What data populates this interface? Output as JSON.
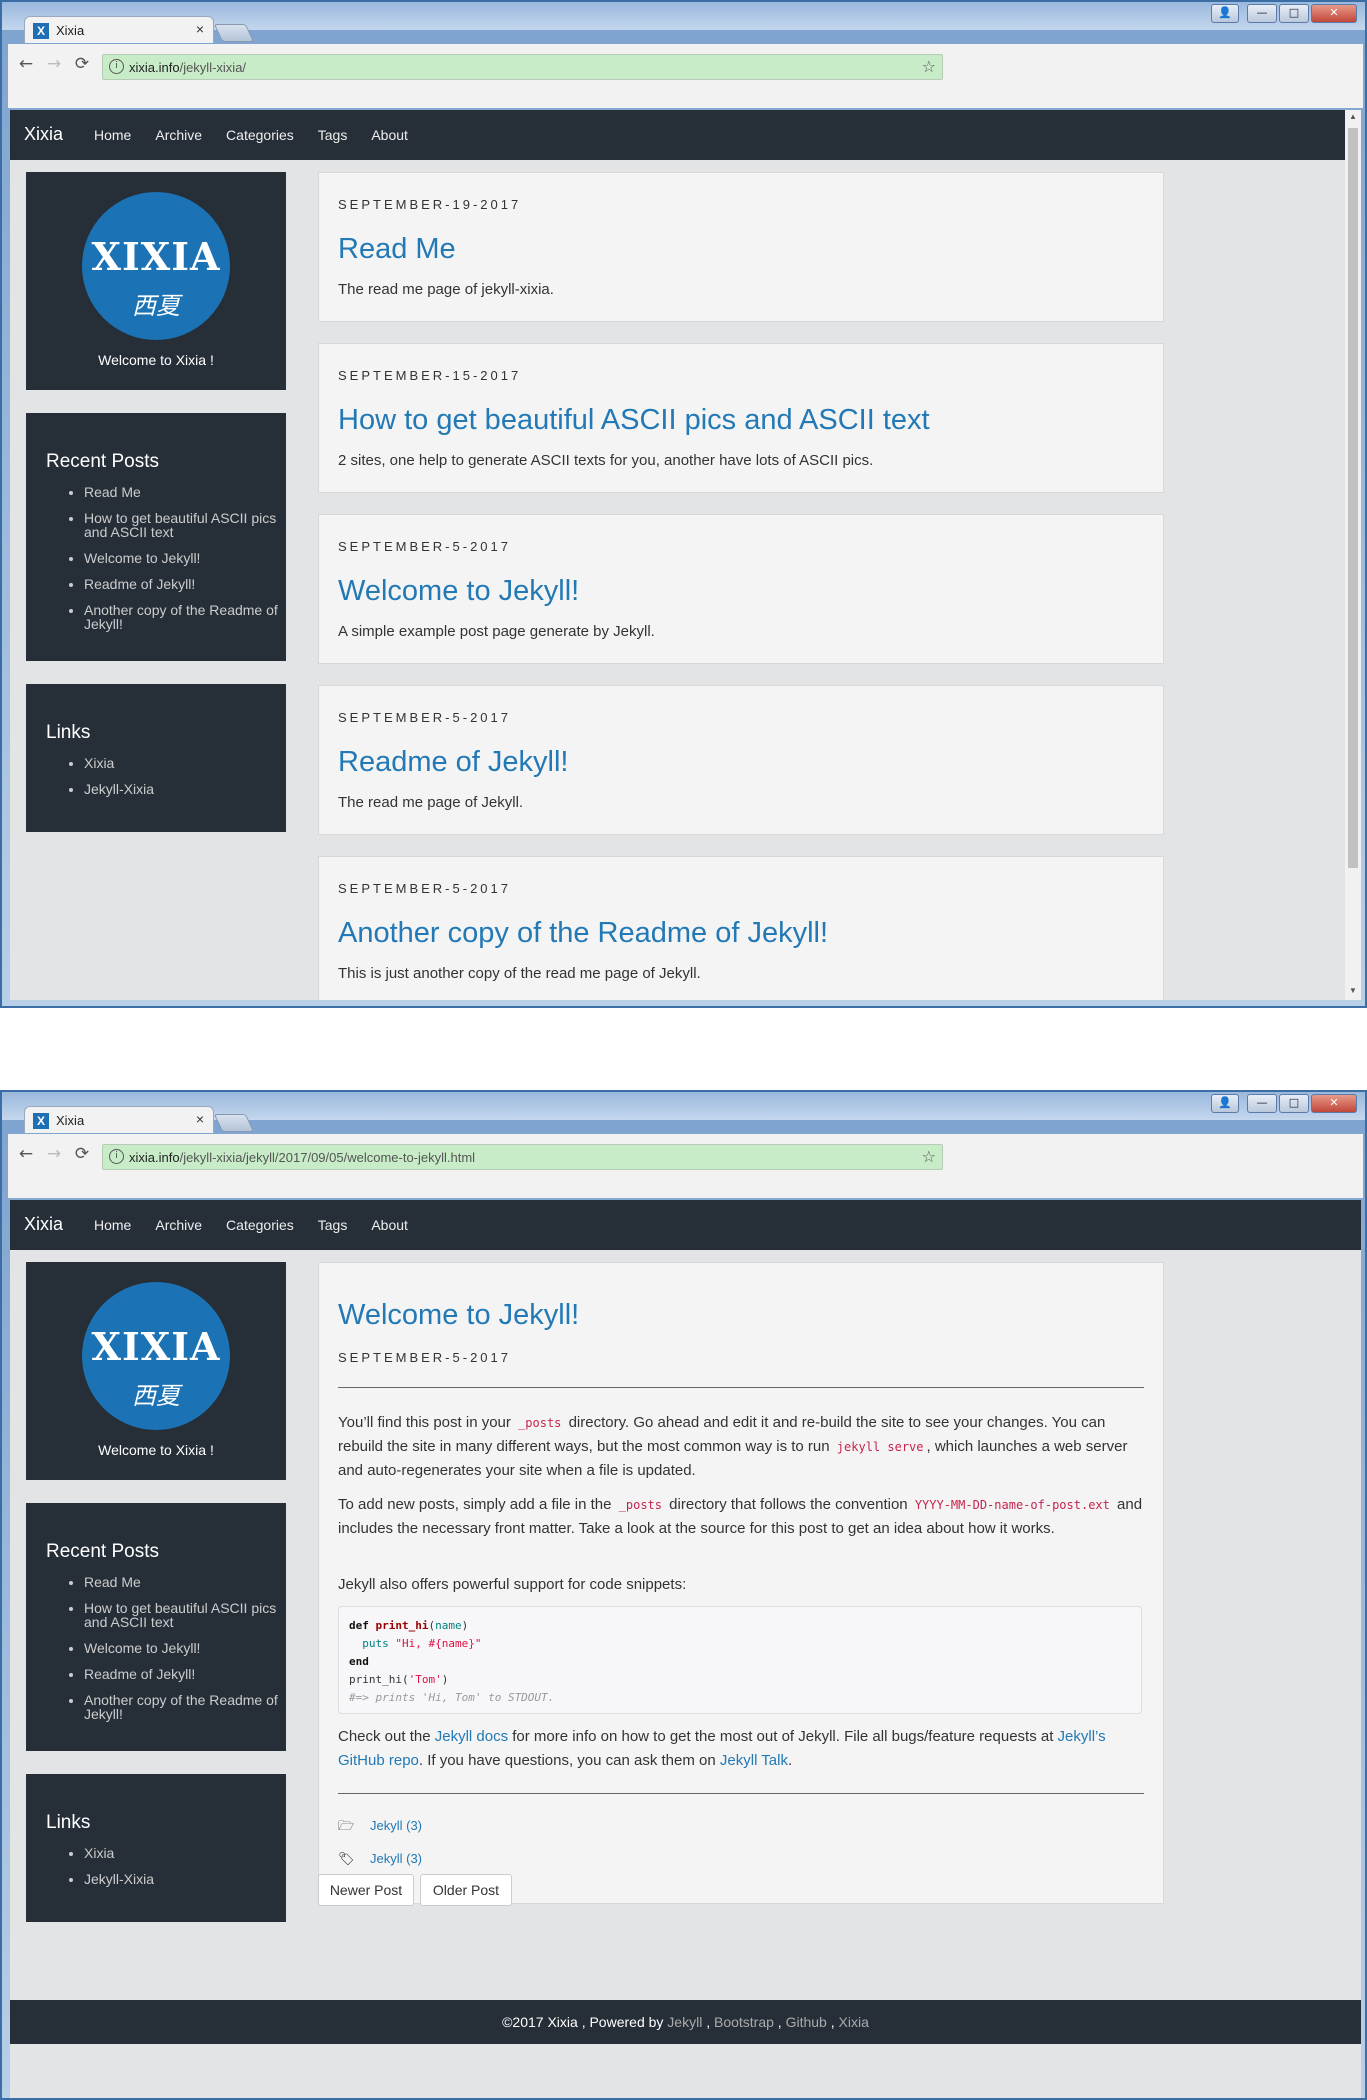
{
  "window": {
    "controls": {
      "user": "👤",
      "minimize": "—",
      "maximize": "□",
      "close": "✕"
    },
    "tab_title": "Xixia",
    "tab_favicon": "X",
    "tab_close": "×",
    "nav_back": "←",
    "nav_forward": "→",
    "nav_reload": "⟳",
    "info_icon": "i",
    "star_icon": "☆"
  },
  "screen1": {
    "url_host": "xixia.info",
    "url_path": "/jekyll-xixia/"
  },
  "screen2": {
    "url_host": "xixia.info",
    "url_path": "/jekyll-xixia/jekyll/2017/09/05/welcome-to-jekyll.html"
  },
  "site": {
    "brand": "Xixia",
    "nav": [
      "Home",
      "Archive",
      "Categories",
      "Tags",
      "About"
    ],
    "logo_big": "XIXIA",
    "logo_small": "西夏",
    "welcome": "Welcome to Xixia !",
    "recent_title": "Recent Posts",
    "recent": [
      "Read Me",
      "How to get beautiful ASCII pics and ASCII text",
      "Welcome to Jekyll!",
      "Readme of Jekyll!",
      "Another copy of the Readme of Jekyll!"
    ],
    "links_title": "Links",
    "links": [
      "Xixia",
      "Jekyll-Xixia"
    ]
  },
  "posts": [
    {
      "date": "SEPTEMBER-19-2017",
      "title": "Read Me",
      "excerpt": "The read me page of jekyll-xixia."
    },
    {
      "date": "SEPTEMBER-15-2017",
      "title": "How to get beautiful ASCII pics and ASCII text",
      "excerpt": "2 sites, one help to generate ASCII texts for you, another have lots of ASCII pics."
    },
    {
      "date": "SEPTEMBER-5-2017",
      "title": "Welcome to Jekyll!",
      "excerpt": "A simple example post page generate by Jekyll."
    },
    {
      "date": "SEPTEMBER-5-2017",
      "title": "Readme of Jekyll!",
      "excerpt": "The read me page of Jekyll."
    },
    {
      "date": "SEPTEMBER-5-2017",
      "title": "Another copy of the Readme of Jekyll!",
      "excerpt": "This is just another copy of the read me page of Jekyll."
    }
  ],
  "article": {
    "title": "Welcome to Jekyll!",
    "date": "SEPTEMBER-5-2017",
    "p1_a": "You’ll find this post in your ",
    "p1_code1": "_posts",
    "p1_b": " directory. Go ahead and edit it and re-build the site to see your changes. You can rebuild the site in many different ways, but the most common way is to run ",
    "p1_code2": "jekyll serve",
    "p1_c": ", which launches a web server and auto-regenerates your site when a file is updated.",
    "p2_a": "To add new posts, simply add a file in the ",
    "p2_code1": "_posts",
    "p2_b": " directory that follows the convention ",
    "p2_code2": "YYYY-MM-DD-name-of-post.ext",
    "p2_c": " and includes the necessary front matter. Take a look at the source for this post to get an idea about how it works.",
    "p3": "Jekyll also offers powerful support for code snippets:",
    "code": {
      "l1_kw": "def",
      "l1_fn": "print_hi",
      "l1_open": "(",
      "l1_var": "name",
      "l1_close": ")",
      "l2_fn": "puts",
      "l2_str": "\"Hi, #{name}\"",
      "l3_kw": "end",
      "l4_a": "print_hi(",
      "l4_str": "'Tom'",
      "l4_b": ")",
      "l5_cm": "#=> prints 'Hi, Tom' to STDOUT."
    },
    "p4_a": "Check out the ",
    "p4_l1": "Jekyll docs",
    "p4_b": " for more info on how to get the most out of Jekyll. File all bugs/feature requests at ",
    "p4_l2": "Jekyll’s GitHub repo",
    "p4_c": ". If you have questions, you can ask them on ",
    "p4_l3": "Jekyll Talk",
    "p4_d": ".",
    "category_icon": "🗁",
    "category": "Jekyll (3)",
    "tag_icon": "🏷",
    "tag": "Jekyll (3)",
    "newer": "Newer Post",
    "older": "Older Post"
  },
  "footer": {
    "a": "©2017 Xixia , Powered by ",
    "l1": "Jekyll",
    "sep1": " , ",
    "l2": "Bootstrap",
    "sep2": " , ",
    "l3": "Github",
    "sep3": " , ",
    "l4": "Xixia"
  }
}
